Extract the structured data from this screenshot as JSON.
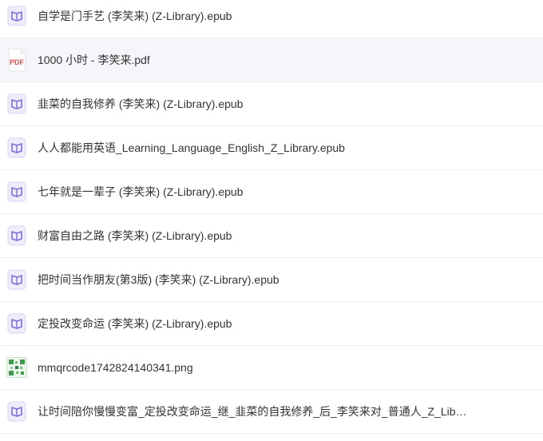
{
  "files": [
    {
      "name": "自学是门手艺 (李笑来) (Z-Library).epub",
      "icon": "epub-icon"
    },
    {
      "name": "1000 小时 - 李笑来.pdf",
      "icon": "pdf-icon",
      "icon_label": "PDF"
    },
    {
      "name": "韭菜的自我修养 (李笑来) (Z-Library).epub",
      "icon": "epub-icon"
    },
    {
      "name": "人人都能用英语_Learning_Language_English_Z_Library.epub",
      "icon": "epub-icon"
    },
    {
      "name": "七年就是一辈子 (李笑来) (Z-Library).epub",
      "icon": "epub-icon"
    },
    {
      "name": "财富自由之路 (李笑来) (Z-Library).epub",
      "icon": "epub-icon"
    },
    {
      "name": "把时间当作朋友(第3版) (李笑来) (Z-Library).epub",
      "icon": "epub-icon"
    },
    {
      "name": "定投改变命运 (李笑来) (Z-Library).epub",
      "icon": "epub-icon"
    },
    {
      "name": "mmqrcode1742824140341.png",
      "icon": "image-thumbnail-icon"
    },
    {
      "name": "让时间陪你慢慢变富_定投改变命运_继_韭菜的自我修养_后_李笑来对_普通人_Z_Librar...",
      "icon": "epub-icon"
    }
  ],
  "colors": {
    "epub_accent": "#7b6fd6",
    "epub_bg": "#efedfb",
    "pdf_red": "#e5484d",
    "hover_bg": "#f5f6fa",
    "text": "#333333"
  }
}
